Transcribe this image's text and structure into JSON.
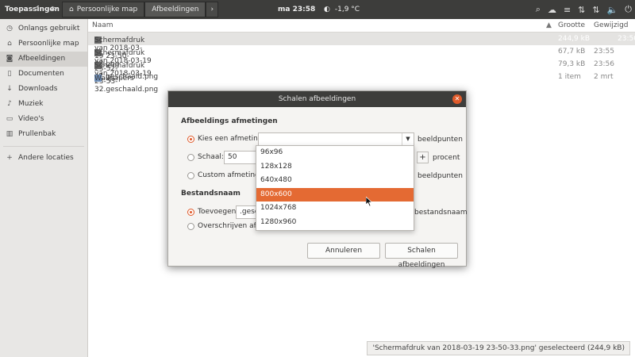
{
  "topbar": {
    "apps_label": "Toepassingen",
    "clock": "ma 23:58",
    "weather": "-1,9 °C",
    "breadcrumbs": [
      "Persoonlijke map",
      "Afbeeldingen"
    ]
  },
  "sidebar": {
    "items": [
      {
        "label": "Onlangs gebruikt",
        "icon": "clock-icon"
      },
      {
        "label": "Persoonlijke map",
        "icon": "home-icon"
      },
      {
        "label": "Afbeeldingen",
        "icon": "camera-icon",
        "active": true
      },
      {
        "label": "Documenten",
        "icon": "document-icon"
      },
      {
        "label": "Downloads",
        "icon": "download-icon"
      },
      {
        "label": "Muziek",
        "icon": "music-icon"
      },
      {
        "label": "Video's",
        "icon": "video-icon"
      },
      {
        "label": "Prullenbak",
        "icon": "trash-icon"
      }
    ],
    "other_locations": "Andere locaties"
  },
  "list": {
    "headers": {
      "name": "Naam",
      "size": "Grootte",
      "modified": "Gewijzigd"
    },
    "rows": [
      {
        "name": "Schermafdruk van 2018-03-19 23-50-33.png",
        "size": "244,9 kB",
        "modified": "23:50",
        "selected": true,
        "icon": "image-file-icon"
      },
      {
        "name": "Schermafdruk van 2018-03-19 23-52-41.geschaald.png",
        "size": "67,7 kB",
        "modified": "23:55",
        "icon": "image-file-icon"
      },
      {
        "name": "Schermafdruk van 2018-03-19 23-53-32.geschaald.png",
        "size": "79,3 kB",
        "modified": "23:56",
        "icon": "image-file-icon"
      },
      {
        "name": "Wallpapers",
        "size": "1 item",
        "modified": "2 mrt",
        "icon": "folder-icon"
      }
    ],
    "status": "'Schermafdruk van 2018-03-19 23-50-33.png' geselecteerd  (244,9 kB)"
  },
  "dialog": {
    "title": "Schalen afbeeldingen",
    "section_size": "Afbeeldings afmetingen",
    "opt_choose": "Kies een afmeting:",
    "unit_pixels": "beeldpunten",
    "opt_scale": "Schaal:",
    "scale_value": "50",
    "unit_percent": "procent",
    "opt_custom": "Custom afmeting:",
    "custom_partial": "B",
    "unit_pixels2": "beeldpunten",
    "section_filename": "Bestandsnaam",
    "opt_append": "Toevoegen",
    "append_value": ".gesch",
    "append_unit": "bestandsnaam",
    "opt_overwrite": "Overschrijven afbee",
    "btn_cancel": "Annuleren",
    "btn_scale": "Schalen afbeeldingen"
  },
  "dropdown": {
    "options": [
      "96x96",
      "128x128",
      "640x480",
      "800x600",
      "1024x768",
      "1280x960"
    ],
    "highlighted": "800x600"
  },
  "colors": {
    "accent": "#e46a33",
    "panel": "#3d3d3b"
  }
}
